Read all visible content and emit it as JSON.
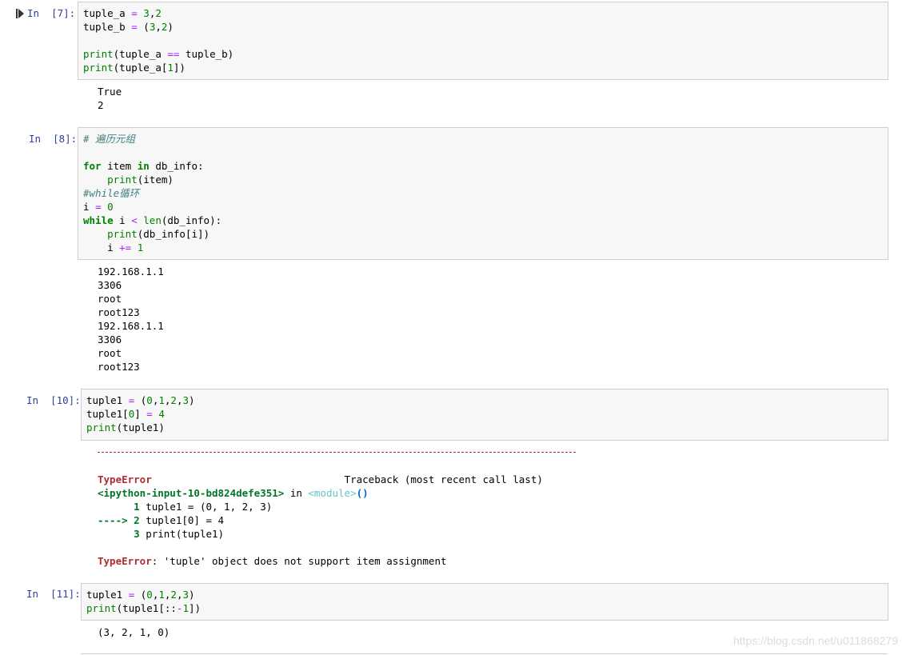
{
  "cells": [
    {
      "prompt": "In  [7]:",
      "code": [
        [
          "tuple_a ",
          {
            "op": "="
          },
          " ",
          {
            "num": "3"
          },
          ",",
          {
            "num": "2"
          }
        ],
        [
          "tuple_b ",
          {
            "op": "="
          },
          " (",
          {
            "num": "3"
          },
          ",",
          {
            "num": "2"
          },
          ")"
        ],
        [
          ""
        ],
        [
          {
            "bi": "print"
          },
          "(tuple_a ",
          {
            "op": "=="
          },
          " tuple_b)"
        ],
        [
          {
            "bi": "print"
          },
          "(tuple_a[",
          {
            "num": "1"
          },
          "])"
        ]
      ],
      "output": [
        "True",
        "2"
      ]
    },
    {
      "prompt": "In  [8]:",
      "code": [
        [
          {
            "cm": "# 遍历元组"
          }
        ],
        [
          ""
        ],
        [
          {
            "kw": "for"
          },
          " item ",
          {
            "kw": "in"
          },
          " db_info:"
        ],
        [
          "    ",
          {
            "bi": "print"
          },
          "(item)"
        ],
        [
          {
            "cm": "#while循环"
          }
        ],
        [
          "i ",
          {
            "op": "="
          },
          " ",
          {
            "num": "0"
          }
        ],
        [
          {
            "kw": "while"
          },
          " i ",
          {
            "op": "<"
          },
          " ",
          {
            "bi": "len"
          },
          "(db_info):"
        ],
        [
          "    ",
          {
            "bi": "print"
          },
          "(db_info[i])"
        ],
        [
          "    i ",
          {
            "op": "+="
          },
          " ",
          {
            "num": "1"
          }
        ]
      ],
      "output": [
        "192.168.1.1",
        "3306",
        "root",
        "root123",
        "192.168.1.1",
        "3306",
        "root",
        "root123"
      ]
    },
    {
      "prompt": "In  [10]:",
      "code": [
        [
          "tuple1 ",
          {
            "op": "="
          },
          " (",
          {
            "num": "0"
          },
          ",",
          {
            "num": "1"
          },
          ",",
          {
            "num": "2"
          },
          ",",
          {
            "num": "3"
          },
          ")"
        ],
        [
          "tuple1[",
          {
            "num": "0"
          },
          "] ",
          {
            "op": "="
          },
          " ",
          {
            "num": "4"
          }
        ],
        [
          {
            "bi": "print"
          },
          "(tuple1)"
        ]
      ],
      "traceback": {
        "error_type": "TypeError",
        "traceback_label": "Traceback (most recent call last)",
        "source": "<ipython-input-10-bd824defe351>",
        "in_word": " in ",
        "module": "<module>",
        "call_parens": "()",
        "line1_num": "      1",
        "line1_code": " tuple1 = (0, 1, 2, 3)",
        "arrow": "----> 2",
        "line2_code": " tuple1[0] = 4",
        "line3_num": "      3",
        "line3_code": " print(tuple1)",
        "error_message": ": 'tuple' object does not support item assignment"
      }
    },
    {
      "prompt": "In  [11]:",
      "code": [
        [
          "tuple1 ",
          {
            "op": "="
          },
          " (",
          {
            "num": "0"
          },
          ",",
          {
            "num": "1"
          },
          ",",
          {
            "num": "2"
          },
          ",",
          {
            "num": "3"
          },
          ")"
        ],
        [
          {
            "bi": "print"
          },
          "(tuple1[::",
          {
            "op": "-"
          },
          {
            "num": "1"
          },
          "])"
        ]
      ],
      "output": [
        "(3, 2, 1, 0)"
      ]
    }
  ],
  "watermark": "https://blog.csdn.net/u011868279"
}
